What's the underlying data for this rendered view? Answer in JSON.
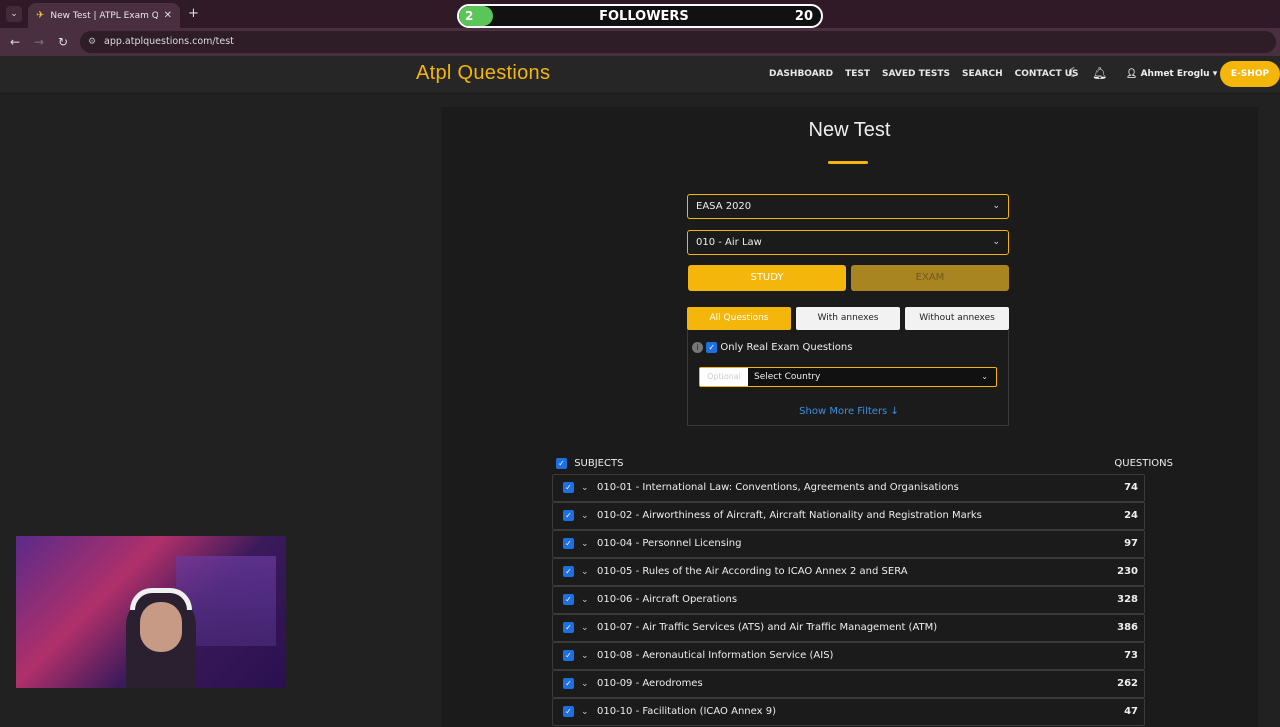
{
  "browser": {
    "tab_title": "New Test | ATPL Exam Question",
    "url": "app.atplquestions.com/test"
  },
  "overlay": {
    "followers_label": "FOLLOWERS",
    "left_count": "2",
    "right_count": "20"
  },
  "header": {
    "logo": "Atpl Questions",
    "nav": [
      "DASHBOARD",
      "TEST",
      "SAVED TESTS",
      "SEARCH",
      "CONTACT US"
    ],
    "user_name": "Ahmet Eroglu",
    "eshop": "E-SHOP"
  },
  "page": {
    "title": "New Test",
    "syllabus": "EASA 2020",
    "subject": "010 - Air Law",
    "study_label": "STUDY",
    "exam_label": "EXAM",
    "segments": [
      "All Questions",
      "With annexes",
      "Without annexes"
    ],
    "only_real_label": "Only Real Exam Questions",
    "country_optional": "Optional",
    "country_placeholder": "Select Country",
    "show_more": "Show More Filters ↓",
    "subjects_header": "SUBJECTS",
    "questions_header": "QUESTIONS"
  },
  "subjects": [
    {
      "name": "010-01 - International Law: Conventions, Agreements and Organisations",
      "count": "74"
    },
    {
      "name": "010-02 - Airworthiness of Aircraft, Aircraft Nationality and Registration Marks",
      "count": "24"
    },
    {
      "name": "010-04 - Personnel Licensing",
      "count": "97"
    },
    {
      "name": "010-05 - Rules of the Air According to ICAO Annex 2 and SERA",
      "count": "230"
    },
    {
      "name": "010-06 - Aircraft Operations",
      "count": "328"
    },
    {
      "name": "010-07 - Air Traffic Services (ATS) and Air Traffic Management (ATM)",
      "count": "386"
    },
    {
      "name": "010-08 - Aeronautical Information Service (AIS)",
      "count": "73"
    },
    {
      "name": "010-09 - Aerodromes",
      "count": "262"
    },
    {
      "name": "010-10 - Facilitation (ICAO Annex 9)",
      "count": "47"
    }
  ],
  "colors": {
    "accent": "#f4b60a",
    "background": "#212121",
    "card": "#1b1b1b",
    "link": "#3b8fe0"
  }
}
